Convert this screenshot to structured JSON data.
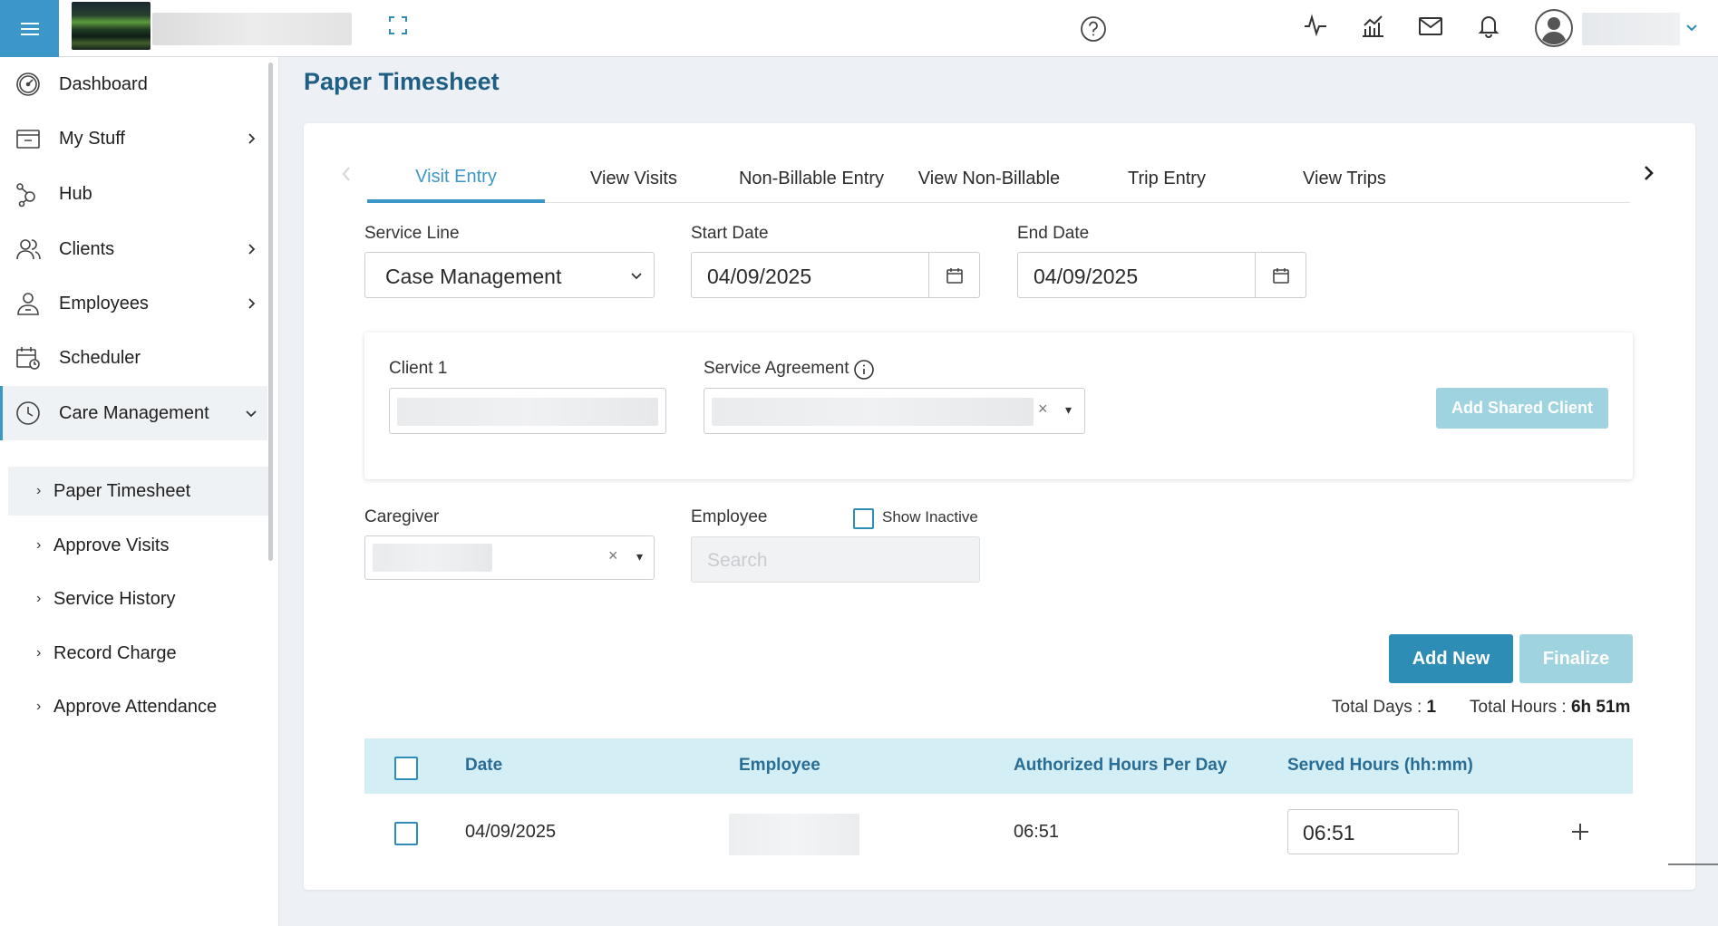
{
  "sidebar": {
    "items": [
      {
        "label": "Dashboard"
      },
      {
        "label": "My Stuff"
      },
      {
        "label": "Hub"
      },
      {
        "label": "Clients"
      },
      {
        "label": "Employees"
      },
      {
        "label": "Scheduler"
      },
      {
        "label": "Care Management"
      }
    ],
    "subitems": [
      {
        "label": "Paper Timesheet"
      },
      {
        "label": "Approve Visits"
      },
      {
        "label": "Service History"
      },
      {
        "label": "Record Charge"
      },
      {
        "label": "Approve Attendance"
      }
    ]
  },
  "page": {
    "title": "Paper Timesheet"
  },
  "tabs": [
    {
      "label": "Visit Entry"
    },
    {
      "label": "View Visits"
    },
    {
      "label": "Non-Billable Entry"
    },
    {
      "label": "View Non-Billable"
    },
    {
      "label": "Trip Entry"
    },
    {
      "label": "View Trips"
    }
  ],
  "form": {
    "service_line": {
      "label": "Service Line",
      "value": "Case Management"
    },
    "start_date": {
      "label": "Start Date",
      "value": "04/09/2025"
    },
    "end_date": {
      "label": "End Date",
      "value": "04/09/2025"
    },
    "client_label": "Client 1",
    "service_agreement_label": "Service Agreement",
    "add_shared_client": "Add Shared Client",
    "caregiver_label": "Caregiver",
    "employee_label": "Employee",
    "show_inactive": "Show Inactive",
    "employee_search_placeholder": "Search",
    "clear_symbol": "×",
    "caret_symbol": "▾"
  },
  "actions": {
    "add_new": "Add New",
    "finalize": "Finalize"
  },
  "totals": {
    "days_label": "Total Days :",
    "days_value": "1",
    "hours_label": "Total Hours :",
    "hours_value": "6h 51m"
  },
  "table": {
    "headers": [
      "Date",
      "Employee",
      "Authorized Hours Per Day",
      "Served Hours (hh:mm)"
    ],
    "rows": [
      {
        "date": "04/09/2025",
        "authorized": "06:51",
        "served": "06:51"
      }
    ]
  },
  "colors": {
    "accent": "#3b97c7",
    "title": "#1f5f86",
    "header_bg": "#d4eef6",
    "button_primary": "#2e8db5",
    "button_disabled": "#9fd3df"
  }
}
